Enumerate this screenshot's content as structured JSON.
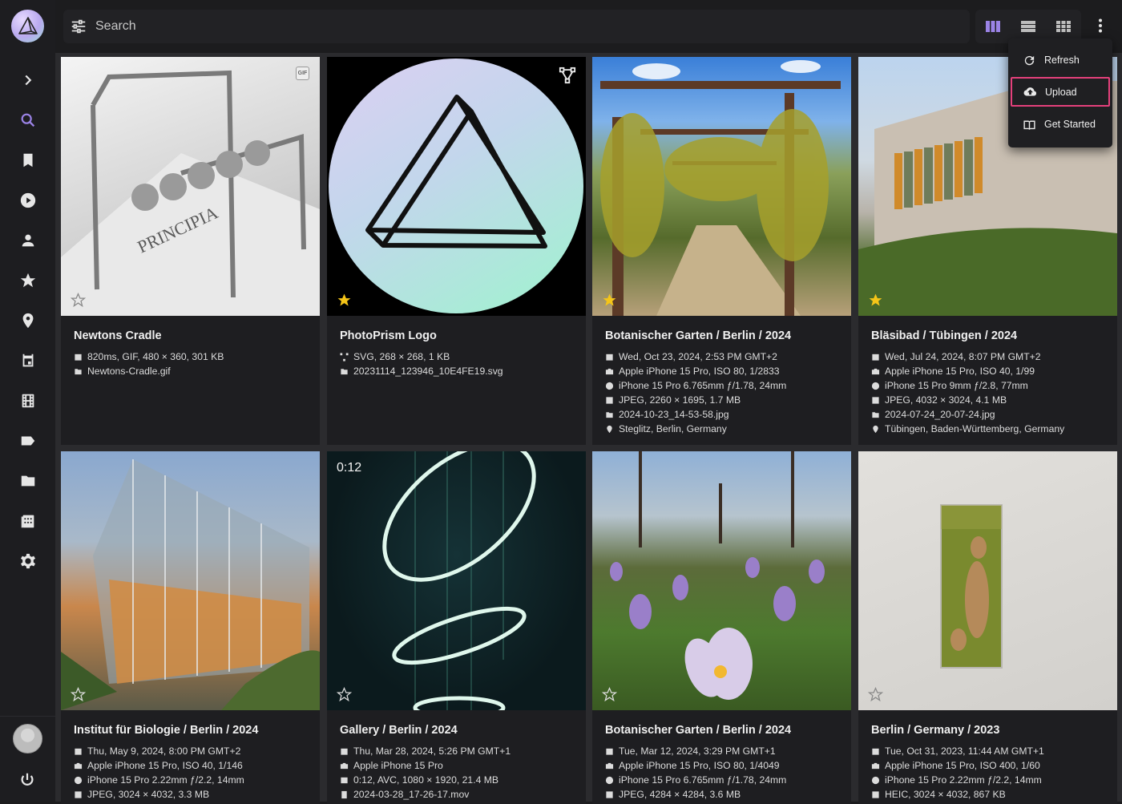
{
  "search": {
    "placeholder": "Search"
  },
  "nav": [
    "expand",
    "search",
    "albums",
    "videos",
    "people",
    "favorites",
    "places",
    "calendar",
    "moments",
    "labels",
    "folders",
    "library",
    "settings"
  ],
  "menu": {
    "items": [
      {
        "label": "Refresh",
        "icon": "refresh-icon"
      },
      {
        "label": "Upload",
        "icon": "cloud-upload-icon"
      },
      {
        "label": "Get Started",
        "icon": "book-open-icon"
      }
    ]
  },
  "colors": {
    "accent": "#9b83e6",
    "favorite": "#f5c518",
    "menu_highlight": "#e4407b"
  },
  "photos": [
    {
      "title": "Newtons Cradle",
      "favorite": false,
      "badge": "GIF",
      "meta": [
        {
          "icon": "calendar",
          "text": "820ms, GIF, 480 × 360, 301 KB"
        },
        {
          "icon": "file",
          "text": "Newtons-Cradle.gif"
        }
      ]
    },
    {
      "title": "PhotoPrism Logo",
      "favorite": true,
      "meta": [
        {
          "icon": "vector",
          "text": "SVG, 268 × 268, 1 KB"
        },
        {
          "icon": "file",
          "text": "20231114_123946_10E4FE19.svg"
        }
      ]
    },
    {
      "title": "Botanischer Garten / Berlin / 2024",
      "favorite": true,
      "meta": [
        {
          "icon": "calendar",
          "text": "Wed, Oct 23, 2024, 2:53 PM GMT+2"
        },
        {
          "icon": "camera",
          "text": "Apple iPhone 15 Pro, ISO 80, 1/2833"
        },
        {
          "icon": "aperture",
          "text": "iPhone 15 Pro 6.765mm ƒ/1.78, 24mm"
        },
        {
          "icon": "image",
          "text": "JPEG, 2260 × 1695, 1.7 MB"
        },
        {
          "icon": "file",
          "text": "2024-10-23_14-53-58.jpg"
        },
        {
          "icon": "pin",
          "text": "Steglitz, Berlin, Germany"
        }
      ]
    },
    {
      "title": "Bläsibad / Tübingen / 2024",
      "favorite": true,
      "meta": [
        {
          "icon": "calendar",
          "text": "Wed, Jul 24, 2024, 8:07 PM GMT+2"
        },
        {
          "icon": "camera",
          "text": "Apple iPhone 15 Pro, ISO 40, 1/99"
        },
        {
          "icon": "aperture",
          "text": "iPhone 15 Pro 9mm ƒ/2.8, 77mm"
        },
        {
          "icon": "image",
          "text": "JPEG, 4032 × 3024, 4.1 MB"
        },
        {
          "icon": "file",
          "text": "2024-07-24_20-07-24.jpg"
        },
        {
          "icon": "pin",
          "text": "Tübingen, Baden-Württemberg, Germany"
        }
      ]
    },
    {
      "title": "Institut für Biologie / Berlin / 2024",
      "favorite": false,
      "meta": [
        {
          "icon": "calendar",
          "text": "Thu, May 9, 2024, 8:00 PM GMT+2"
        },
        {
          "icon": "camera",
          "text": "Apple iPhone 15 Pro, ISO 40, 1/146"
        },
        {
          "icon": "aperture",
          "text": "iPhone 15 Pro 2.22mm ƒ/2.2, 14mm"
        },
        {
          "icon": "image",
          "text": "JPEG, 3024 × 4032, 3.3 MB"
        }
      ]
    },
    {
      "title": "Gallery / Berlin / 2024",
      "favorite": false,
      "duration": "0:12",
      "meta": [
        {
          "icon": "calendar",
          "text": "Thu, Mar 28, 2024, 5:26 PM GMT+1"
        },
        {
          "icon": "camera",
          "text": "Apple iPhone 15 Pro"
        },
        {
          "icon": "film",
          "text": "0:12, AVC, 1080 × 1920, 21.4 MB"
        },
        {
          "icon": "film",
          "text": "2024-03-28_17-26-17.mov"
        }
      ]
    },
    {
      "title": "Botanischer Garten / Berlin / 2024",
      "favorite": false,
      "meta": [
        {
          "icon": "calendar",
          "text": "Tue, Mar 12, 2024, 3:29 PM GMT+1"
        },
        {
          "icon": "camera",
          "text": "Apple iPhone 15 Pro, ISO 80, 1/4049"
        },
        {
          "icon": "aperture",
          "text": "iPhone 15 Pro 6.765mm ƒ/1.78, 24mm"
        },
        {
          "icon": "image",
          "text": "JPEG, 4284 × 4284, 3.6 MB"
        }
      ]
    },
    {
      "title": "Berlin / Germany / 2023",
      "favorite": false,
      "meta": [
        {
          "icon": "calendar",
          "text": "Tue, Oct 31, 2023, 11:44 AM GMT+1"
        },
        {
          "icon": "camera",
          "text": "Apple iPhone 15 Pro, ISO 400, 1/60"
        },
        {
          "icon": "aperture",
          "text": "iPhone 15 Pro 2.22mm ƒ/2.2, 14mm"
        },
        {
          "icon": "image",
          "text": "HEIC, 3024 × 4032, 867 KB"
        }
      ]
    }
  ]
}
